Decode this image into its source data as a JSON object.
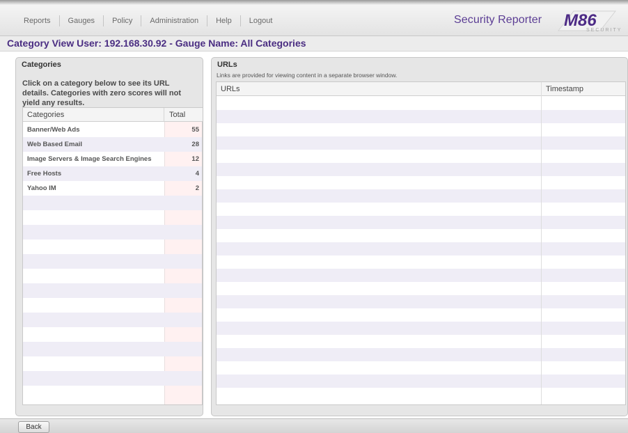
{
  "nav": {
    "items": [
      "Reports",
      "Gauges",
      "Policy",
      "Administration",
      "Help",
      "Logout"
    ]
  },
  "brand": {
    "title": "Security Reporter",
    "logo_text": "M86",
    "logo_sub": "SECURITY"
  },
  "page": {
    "title": "Category View User: 192.168.30.92 - Gauge Name: All Categories"
  },
  "categories_panel": {
    "title": "Categories",
    "instructions": "Click on a category below to see its URL details. Categories with zero scores will not yield any results.",
    "headers": {
      "name": "Categories",
      "total": "Total"
    },
    "rows": [
      {
        "name": "Banner/Web Ads",
        "total": "55"
      },
      {
        "name": "Web Based Email",
        "total": "28"
      },
      {
        "name": "Image Servers & Image Search Engines",
        "total": "12"
      },
      {
        "name": "Free Hosts",
        "total": "4"
      },
      {
        "name": "Yahoo IM",
        "total": "2"
      }
    ]
  },
  "urls_panel": {
    "title": "URLs",
    "note": "Links are provided for viewing content in a separate browser window.",
    "headers": {
      "url": "URLs",
      "timestamp": "Timestamp"
    }
  },
  "footer": {
    "back_label": "Back"
  },
  "colors": {
    "accent": "#4a2d82",
    "brand": "#5b3d94",
    "row_alt": "#efedf6"
  }
}
